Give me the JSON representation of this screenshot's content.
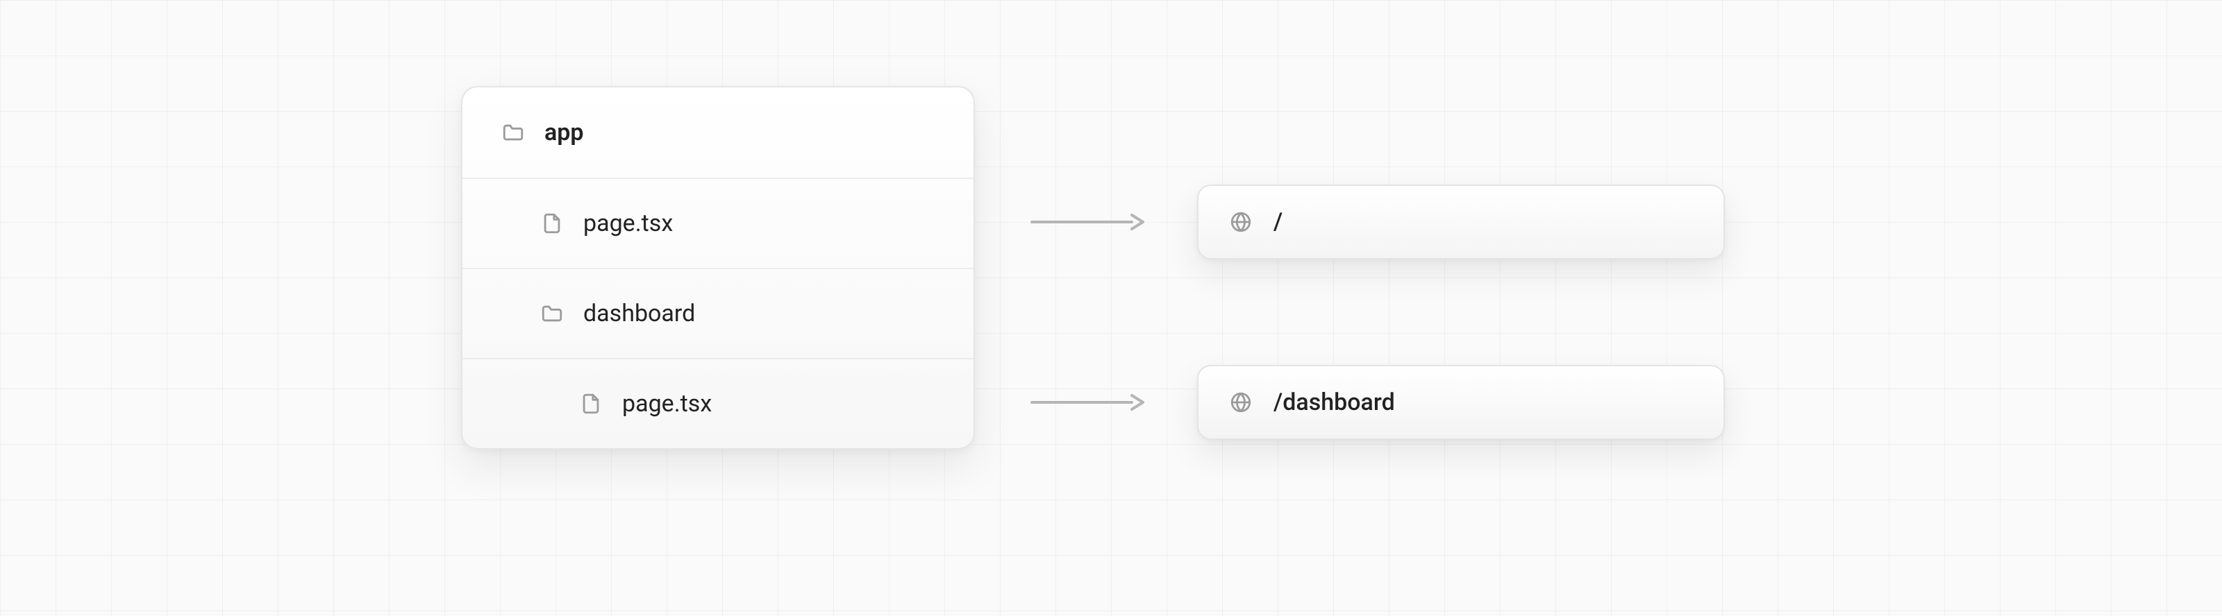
{
  "tree": {
    "root": {
      "label": "app",
      "icon": "folder"
    },
    "items": [
      {
        "label": "page.tsx",
        "icon": "file",
        "depth": 1
      },
      {
        "label": "dashboard",
        "icon": "folder",
        "depth": 1
      },
      {
        "label": "page.tsx",
        "icon": "file",
        "depth": 2
      }
    ]
  },
  "routes": [
    {
      "path": "/"
    },
    {
      "path": "/dashboard"
    }
  ]
}
